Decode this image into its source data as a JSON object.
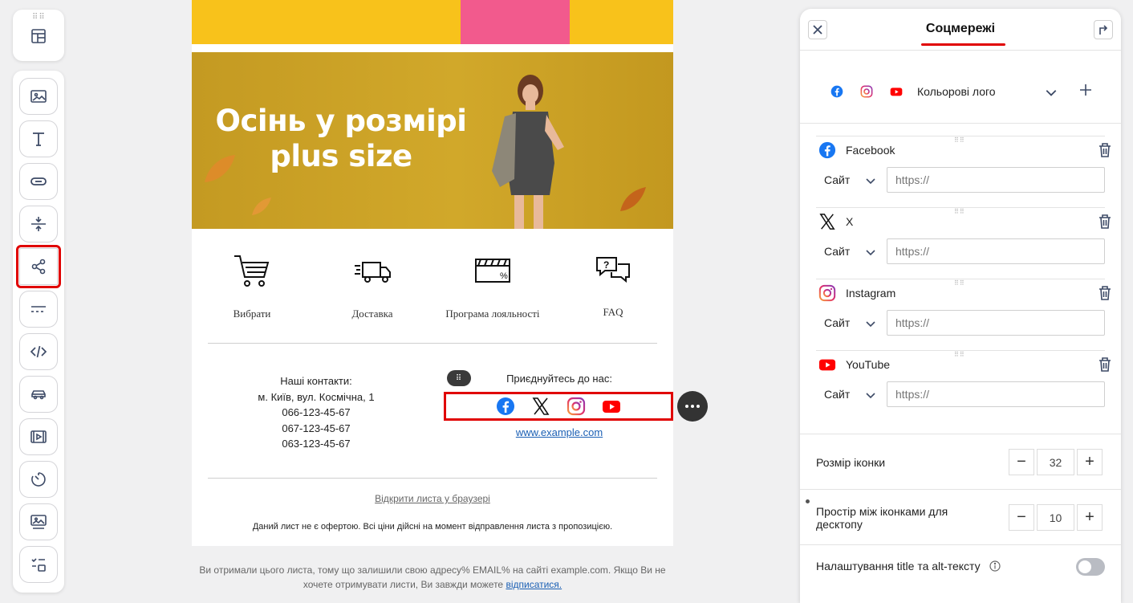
{
  "email": {
    "banner_title_line1": "Осінь у розмірі",
    "banner_title_line2": "plus size",
    "features": [
      {
        "label": "Вибрати",
        "icon": "cart-icon"
      },
      {
        "label": "Доставка",
        "icon": "truck-icon"
      },
      {
        "label": "Програма лояльності",
        "icon": "loyalty-card-icon"
      },
      {
        "label": "FAQ",
        "icon": "faq-chat-icon"
      }
    ],
    "contacts": {
      "title": "Наші контакти:",
      "address": "м. Київ, вул. Космічна, 1",
      "phones": [
        "066-123-45-67",
        "067-123-45-67",
        "063-123-45-67"
      ]
    },
    "join_title": "Приєднуйтесь до нас:",
    "site_link": "www.example.com",
    "browser_link": "Відкрити листа у браузері",
    "disclaimer": "Даний лист не є офертою. Всі ціни дійсні на момент відправлення листа з пропозицією."
  },
  "footer": {
    "line1": "Ви отримали цього листа, тому що залишили свою адресу% EMAIL% на сайті example.com. Якщо Ви не",
    "line2": "хочете отримувати листи, Ви завжди можете ",
    "unsubscribe": "відписатися."
  },
  "panel": {
    "title": "Соцмережі",
    "style_label": "Кольорові лого",
    "networks": [
      {
        "name": "Facebook",
        "type": "Сайт",
        "url_placeholder": "https://",
        "icon": "facebook-icon"
      },
      {
        "name": "X",
        "type": "Сайт",
        "url_placeholder": "https://",
        "icon": "x-icon"
      },
      {
        "name": "Instagram",
        "type": "Сайт",
        "url_placeholder": "https://",
        "icon": "instagram-icon"
      },
      {
        "name": "YouTube",
        "type": "Сайт",
        "url_placeholder": "https://",
        "icon": "youtube-icon"
      }
    ],
    "icon_size_label": "Розмір іконки",
    "icon_size_value": "32",
    "spacing_label_line1": "Простір між іконками для",
    "spacing_label_line2": "десктопу",
    "spacing_value": "10",
    "alt_text_label": "Налаштування title та alt-тексту",
    "alt_text_enabled": false
  },
  "colors": {
    "accent_red": "#e00000",
    "facebook": "#1877f2",
    "youtube": "#ff0000",
    "link": "#1a5fb4"
  }
}
